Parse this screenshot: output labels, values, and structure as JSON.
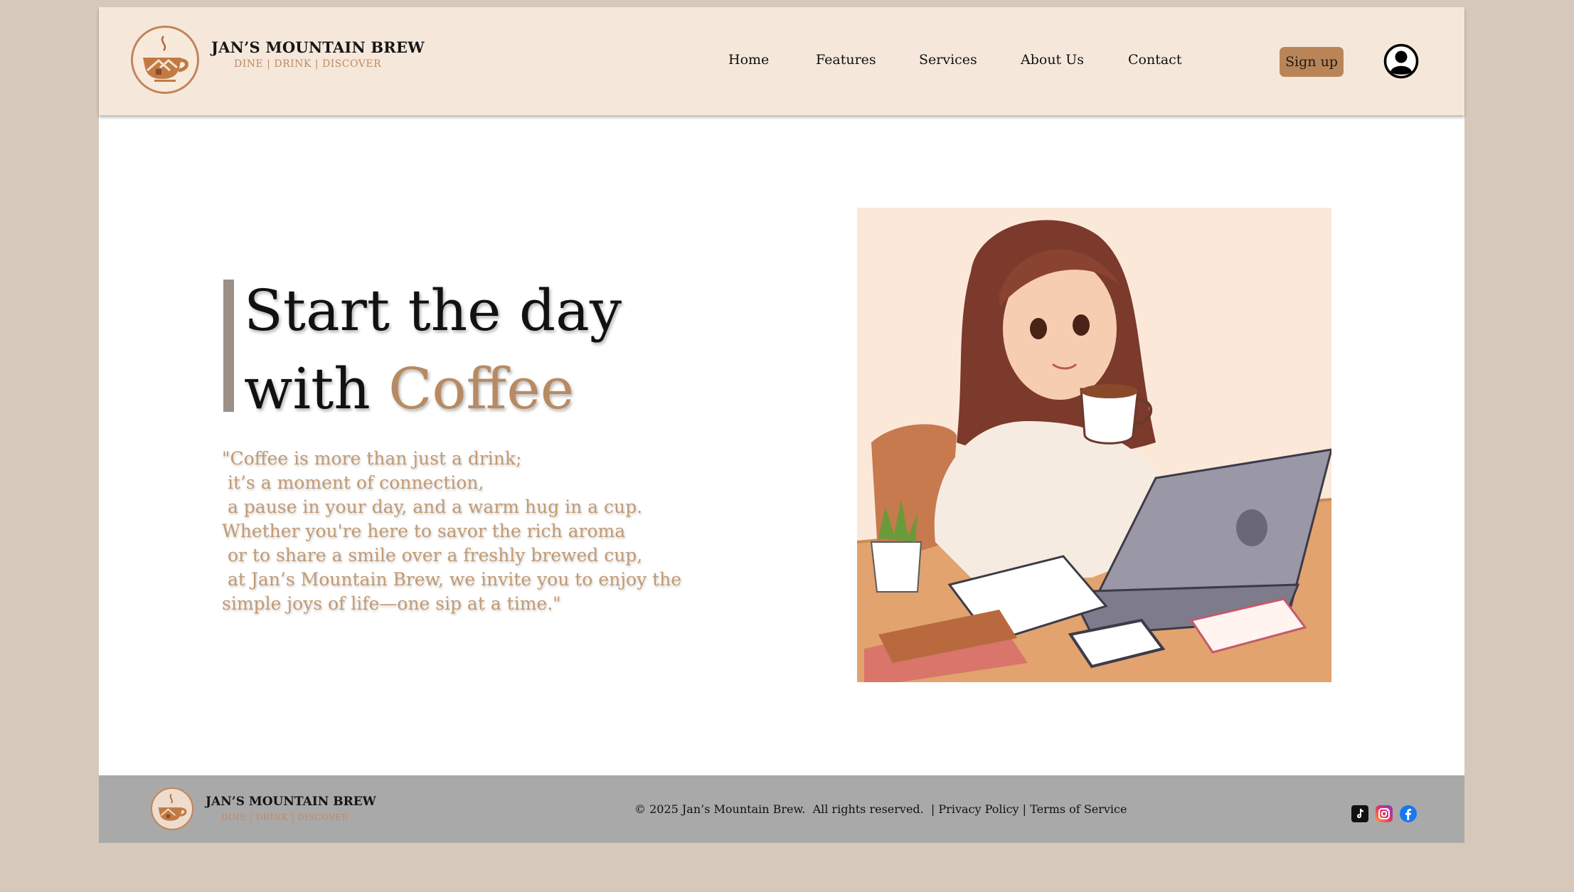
{
  "brand": {
    "name": "JAN’S MOUNTAIN BREW",
    "tagline": "DINE | DRINK | DISCOVER"
  },
  "nav": {
    "items": [
      {
        "label": "Home"
      },
      {
        "label": "Features"
      },
      {
        "label": "Services"
      },
      {
        "label": "About Us"
      },
      {
        "label": "Contact"
      }
    ],
    "signup_label": "Sign up",
    "user_icon": "user-circle-icon"
  },
  "hero": {
    "title_line1": "Start the day",
    "title_line2_prefix": "with ",
    "title_accent": "Coffee",
    "quote": "\"Coffee is more than just a drink;\n it’s a moment of connection,\n a pause in your day, and a warm hug in a cup.\nWhether you're here to savor the rich aroma\n or to share a smile over a freshly brewed cup,\n at Jan’s Mountain Brew, we invite you to enjoy the\nsimple joys of life—one sip at a time.\"",
    "image": "illustration of woman drinking coffee at desk with laptop"
  },
  "footer": {
    "brand_name": "JAN’S MOUNTAIN BREW",
    "tagline": "DINE | DRINK | DISCOVER",
    "copyright": "© 2025 Jan’s Mountain Brew.  All rights reserved.  | ",
    "privacy": "Privacy Policy",
    "separator": " | ",
    "terms": "Terms of Service",
    "social": [
      "tiktok-icon",
      "instagram-icon",
      "facebook-icon"
    ]
  },
  "colors": {
    "header_bg": "#f5e8da",
    "accent": "#b88a62",
    "signup_bg": "#b98558",
    "footer_bg": "#a9a9a9",
    "page_bg": "#d6c9bb"
  }
}
